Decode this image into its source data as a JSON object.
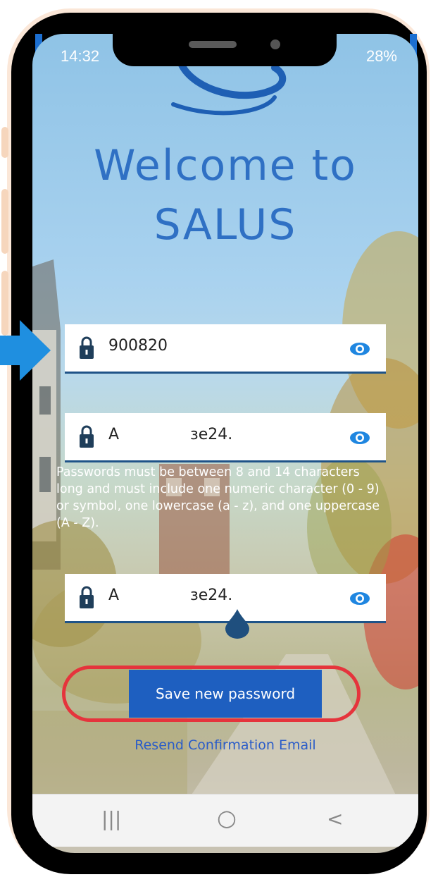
{
  "status_bar": {
    "time": "14:32",
    "battery": "28%"
  },
  "welcome": {
    "line1": "Welcome to",
    "line2": "SALUS"
  },
  "fields": {
    "code": {
      "value": "900820"
    },
    "new_password": {
      "value_start": "A",
      "value_end": "зe24."
    },
    "confirm_password": {
      "value_start": "A",
      "value_end": "зe24."
    }
  },
  "hint": "Passwords must be between 8 and 14 characters long and must include one numeric character (0 - 9) or symbol, one lowercase (a - z), and one uppercase (A - Z).",
  "actions": {
    "save_label": "Save new password",
    "resend_label": "Resend Confirmation Email"
  },
  "nav": {
    "recent": "|||",
    "home": "○",
    "back": "<"
  },
  "colors": {
    "brand_blue": "#2f70c4",
    "button_blue": "#1e5fc0",
    "field_underline": "#1f5388",
    "highlight_red": "#e5343c",
    "arrow_blue": "#1f8fe0"
  },
  "icons": [
    "lock-icon",
    "eye-icon",
    "salus-logo"
  ]
}
